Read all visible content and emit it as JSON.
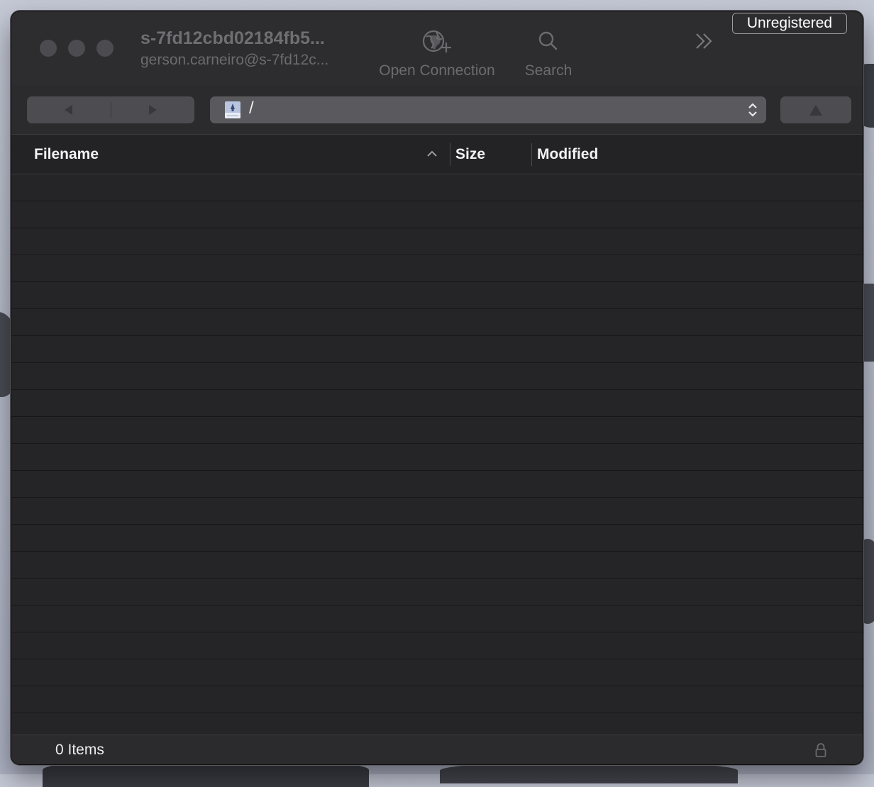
{
  "window": {
    "title": "s-7fd12cbd02184fb5...",
    "subtitle": "gerson.carneiro@s-7fd12c..."
  },
  "toolbar": {
    "open_connection_label": "Open Connection",
    "open_connection_icon": "globe-plus-icon",
    "search_label": "Search",
    "search_icon": "magnifier-icon",
    "overflow_icon": "double-chevron-right-icon",
    "unregistered_label": "Unregistered"
  },
  "navigation": {
    "back_icon": "triangle-left-icon",
    "forward_icon": "triangle-right-icon",
    "path": "/",
    "path_icon": "disk-icon",
    "up_icon": "triangle-up-icon"
  },
  "columns": {
    "filename": "Filename",
    "size": "Size",
    "modified": "Modified",
    "sort_direction": "ascending"
  },
  "files": [],
  "status": {
    "items_text": "0 Items",
    "lock_icon": "lock-icon"
  },
  "colors": {
    "window_bg": "#232325",
    "titlebar_bg": "#2d2d30",
    "path_bg": "#5a5a5e"
  }
}
